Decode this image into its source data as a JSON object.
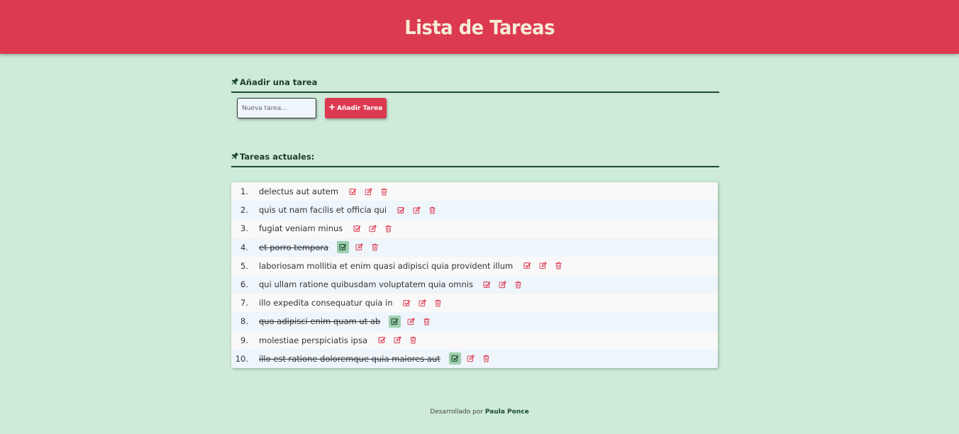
{
  "header": {
    "title": "Lista de Tareas"
  },
  "add_section": {
    "title": "Añadir una tarea",
    "input_placeholder": "Nueva tarea...",
    "button_label": "Añadir Tarea"
  },
  "current_section": {
    "title": "Tareas actuales:"
  },
  "tasks": [
    {
      "num": "1.",
      "text": "delectus aut autem",
      "done": false
    },
    {
      "num": "2.",
      "text": "quis ut nam facilis et officia qui",
      "done": false
    },
    {
      "num": "3.",
      "text": "fugiat veniam minus",
      "done": false
    },
    {
      "num": "4.",
      "text": "et porro tempora",
      "done": true
    },
    {
      "num": "5.",
      "text": "laboriosam mollitia et enim quasi adipisci quia provident illum",
      "done": false
    },
    {
      "num": "6.",
      "text": "qui ullam ratione quibusdam voluptatem quia omnis",
      "done": false
    },
    {
      "num": "7.",
      "text": "illo expedita consequatur quia in",
      "done": false
    },
    {
      "num": "8.",
      "text": "quo adipisci enim quam ut ab",
      "done": true
    },
    {
      "num": "9.",
      "text": "molestiae perspiciatis ipsa",
      "done": false
    },
    {
      "num": "10.",
      "text": "illo est ratione doloremque quia maiores aut",
      "done": true
    }
  ],
  "footer": {
    "prefix": "Desarrollado por",
    "author": "Paula Ponce"
  },
  "colors": {
    "accent": "#dc3a50",
    "background": "#cdebd8",
    "dark_green": "#1e4a30",
    "checked_bg": "#9ecfae"
  },
  "icons": {
    "complete": "check-square-icon",
    "edit": "edit-icon",
    "delete": "trash-icon",
    "section": "pin-icon",
    "add": "plus-icon"
  }
}
